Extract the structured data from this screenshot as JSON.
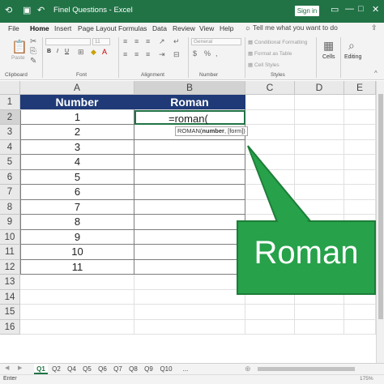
{
  "titlebar": {
    "qa_save_icon": "save-icon",
    "title": "Finel Questions  -  Excel",
    "signin": "Sign in",
    "min": "—",
    "restore": "□",
    "close": "✕"
  },
  "menu": {
    "items": [
      "File",
      "Home",
      "Insert",
      "Page Layout",
      "Formulas",
      "Data",
      "Review",
      "View",
      "Help"
    ],
    "tell": "Tell me what you want to do"
  },
  "ribbon": {
    "clipboard": "Clipboard",
    "paste": "Paste",
    "font": "Font",
    "font_size": "11",
    "alignment": "Alignment",
    "number": "Number",
    "number_format": "General",
    "conditional": "Conditional Formatting",
    "format_table": "Format as Table",
    "cell_styles": "Cell Styles",
    "styles": "Styles",
    "cells": "Cells",
    "editing": "Editing"
  },
  "grid": {
    "columns": [
      "A",
      "B",
      "C",
      "D",
      "E"
    ],
    "rows": [
      "1",
      "2",
      "3",
      "4",
      "5",
      "6",
      "7",
      "8",
      "9",
      "10",
      "11",
      "12",
      "13",
      "14",
      "15",
      "16"
    ],
    "header_number": "Number",
    "header_roman": "Roman",
    "numbers": [
      "1",
      "2",
      "3",
      "4",
      "5",
      "6",
      "7",
      "8",
      "9",
      "10",
      "11"
    ],
    "active_formula": "=roman(",
    "tooltip_fn": "ROMAN(",
    "tooltip_arg": "number",
    "tooltip_rest": ", [form])"
  },
  "callout": {
    "text": "Roman"
  },
  "tabs": [
    "Q1",
    "Q2",
    "Q4",
    "Q5",
    "Q6",
    "Q7",
    "Q8",
    "Q9",
    "Q10",
    "..."
  ],
  "status": {
    "text": "Enter",
    "zoom": "175%"
  },
  "colors": {
    "excel_green": "#217346",
    "header_blue": "#1f3a77",
    "callout_green": "#27a14a"
  }
}
